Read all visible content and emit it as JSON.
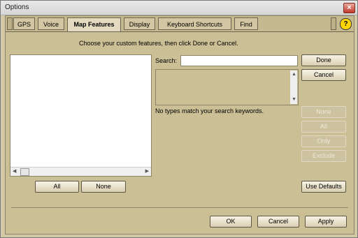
{
  "window": {
    "title": "Options",
    "close_label": "×"
  },
  "tabs": [
    "GPS",
    "Voice",
    "Map Features",
    "Display",
    "Keyboard Shortcuts",
    "Find"
  ],
  "active_tab": "Map Features",
  "help_label": "?",
  "instruction": "Choose your custom features, then click Done or Cancel.",
  "list": {
    "all_label": "All",
    "none_label": "None"
  },
  "search": {
    "label": "Search:",
    "value": "",
    "placeholder": ""
  },
  "results_message": "No types match your search keywords.",
  "side_buttons": {
    "done": "Done",
    "cancel": "Cancel",
    "none": "None",
    "all": "All",
    "only": "Only",
    "exclude": "Exclude",
    "use_defaults": "Use Defaults"
  },
  "footer": {
    "ok": "OK",
    "cancel": "Cancel",
    "apply": "Apply"
  }
}
